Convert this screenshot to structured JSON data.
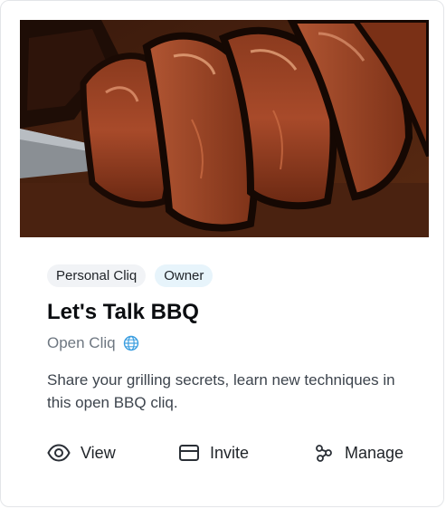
{
  "card": {
    "image_alt": "Sliced smoked brisket",
    "badges": [
      {
        "label": "Personal Cliq"
      },
      {
        "label": "Owner"
      }
    ],
    "title": "Let's Talk BBQ",
    "type_label": "Open Cliq",
    "type_icon": "globe-icon",
    "description": "Share your grilling secrets, learn new techniques in this open BBQ cliq.",
    "actions": [
      {
        "label": "View",
        "icon": "eye-icon"
      },
      {
        "label": "Invite",
        "icon": "card-icon"
      },
      {
        "label": "Manage",
        "icon": "manage-icon"
      }
    ]
  },
  "colors": {
    "globe": "#3b9ee0",
    "owner_badge_bg": "#e7f4fb",
    "personal_badge_bg": "#f1f3f6"
  }
}
